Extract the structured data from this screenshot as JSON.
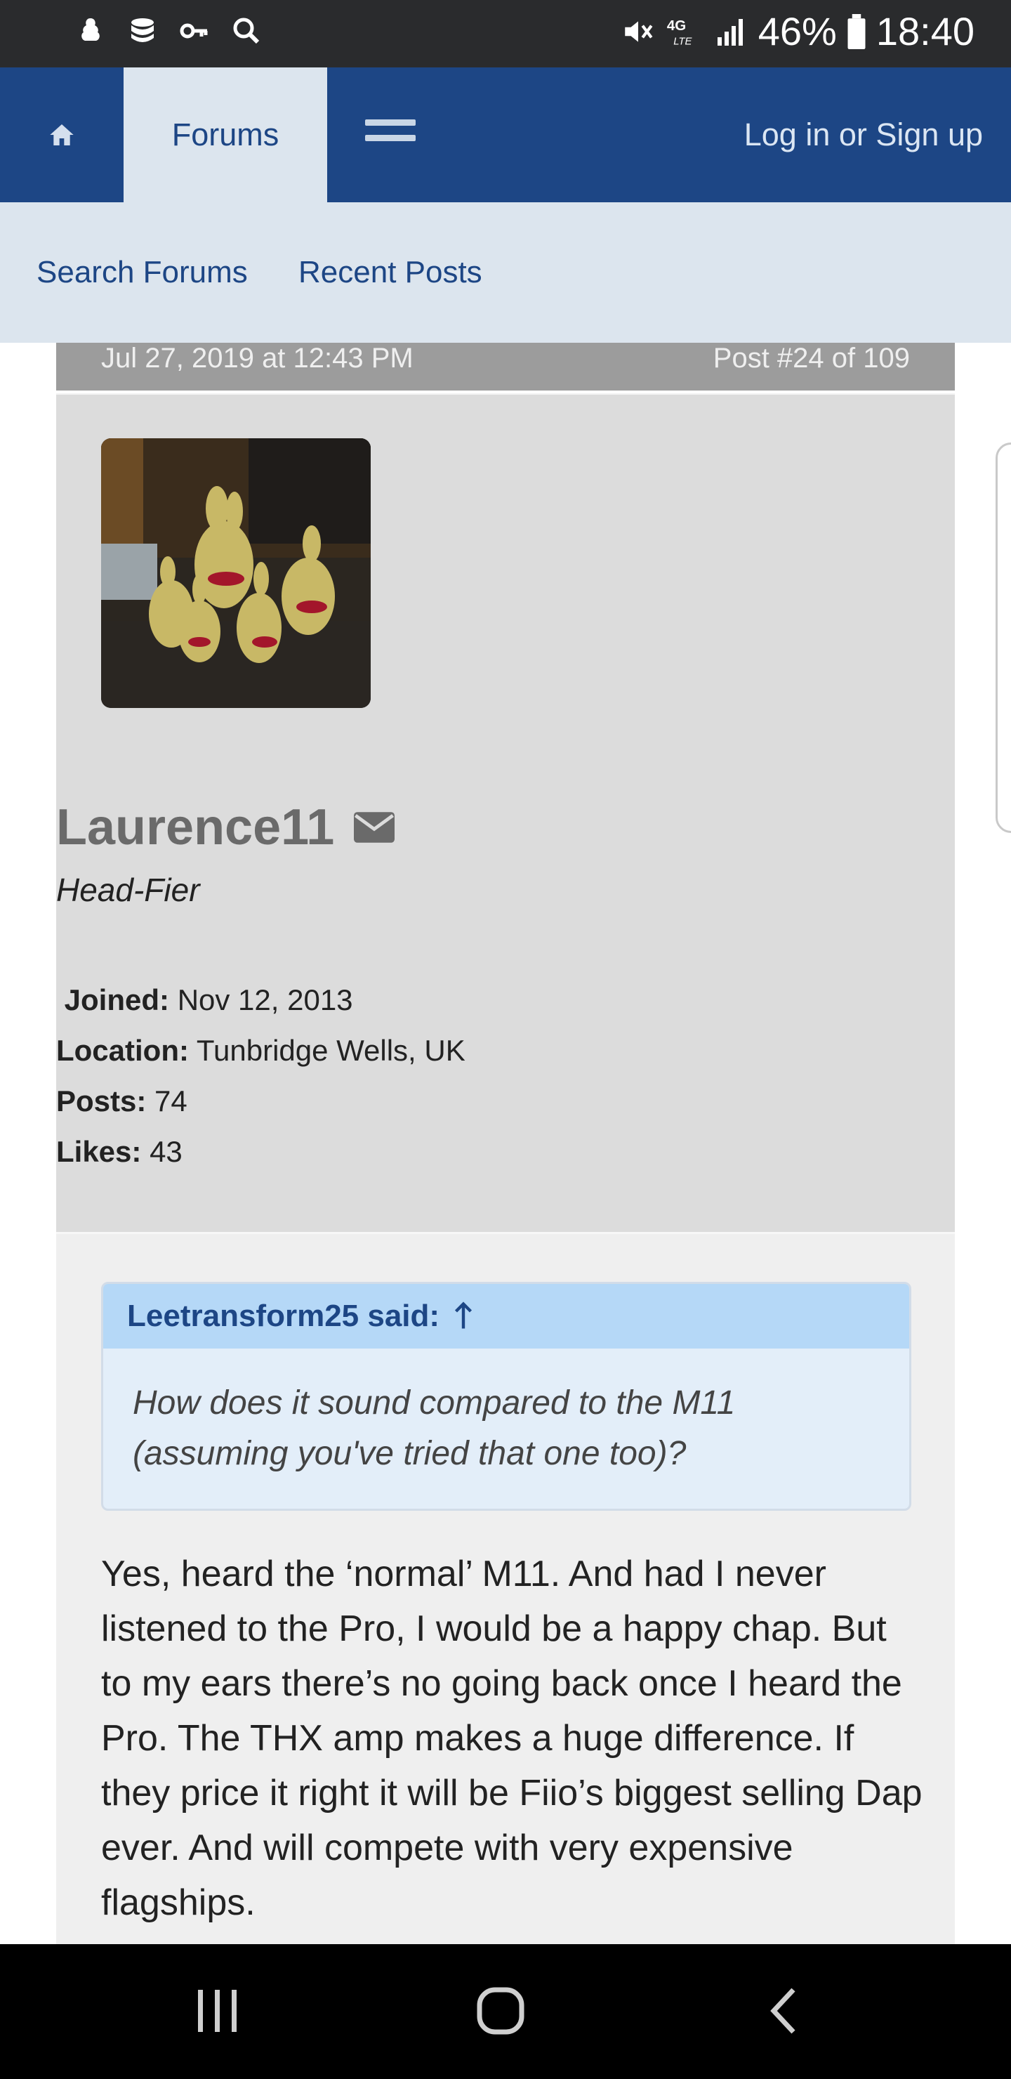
{
  "status_bar": {
    "battery": "46%",
    "time": "18:40"
  },
  "nav": {
    "home_icon": "home-icon",
    "forums": "Forums",
    "menu_icon": "hamburger-icon",
    "login": "Log in or Sign up"
  },
  "subnav": {
    "search": "Search Forums",
    "recent": "Recent Posts"
  },
  "post": {
    "date": "Jul 27, 2019 at 12:43 PM",
    "number": "Post #24 of 109",
    "username": "Laurence11",
    "user_title": "Head-Fier",
    "stats": {
      "joined_label": "Joined:",
      "joined": "Nov 12, 2013",
      "location_label": "Location:",
      "location": "Tunbridge Wells, UK",
      "posts_label": "Posts:",
      "posts": "74",
      "likes_label": "Likes:",
      "likes": "43"
    },
    "quote": {
      "author": "Leetransform25 said:",
      "text": "How does it sound compared to the M11 (assuming you've tried that one too)?"
    },
    "body": "Yes, heard the ‘normal’ M11. And had I never listened to the Pro, I would be a happy chap. But to my ears there’s no going back once I heard the Pro. The THX amp makes a huge difference. If they price it right it will be Fiio’s biggest selling Dap ever. And will compete with very expensive flagships."
  },
  "colors": {
    "nav_bg": "#1d4685",
    "subnav_bg": "#dce5ee",
    "quote_head": "#b5d8f7"
  }
}
